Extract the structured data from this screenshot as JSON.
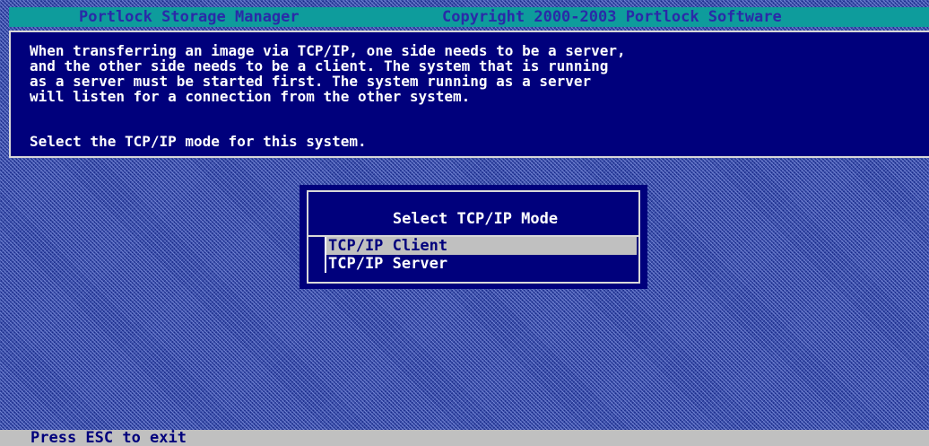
{
  "title_bar": {
    "app_name": "Portlock Storage Manager",
    "copyright": "Copyright 2000-2003 Portlock Software"
  },
  "info_panel": {
    "lines": [
      "When transferring an image via TCP/IP, one side needs to be a server,",
      "and the other side needs to be a client. The system that is running",
      "as a server must be started first. The system running as a server",
      "will listen for a connection from the other system."
    ],
    "prompt": "Select the TCP/IP mode for this system."
  },
  "dialog": {
    "title": "Select TCP/IP Mode",
    "options": [
      {
        "label": "TCP/IP Client",
        "selected": true
      },
      {
        "label": "TCP/IP Server",
        "selected": false
      }
    ]
  },
  "status_bar": {
    "text": "Press ESC to exit"
  },
  "colors": {
    "title_bg": "#0e9c9c",
    "title_text": "#2a2aa8",
    "panel_bg": "#00007c",
    "highlight": "#c0c0c0",
    "text": "#ffffff"
  }
}
